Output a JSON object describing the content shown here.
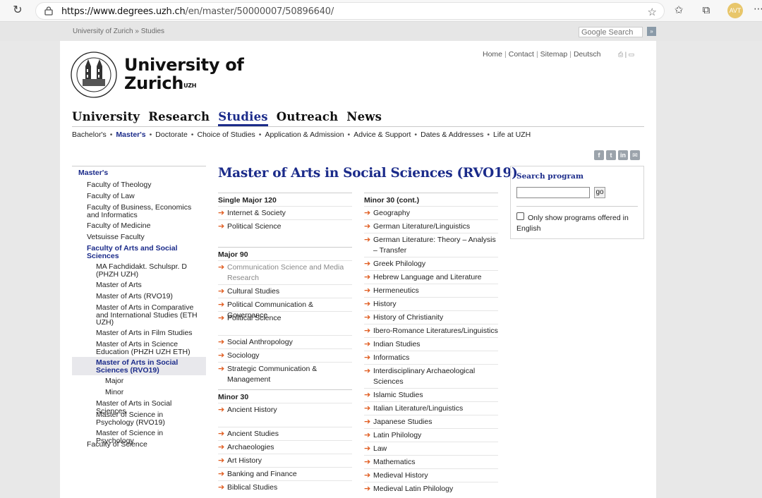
{
  "browser": {
    "url_host": "https://www.degrees.uzh.ch",
    "url_path": "/en/master/50000007/50896640/",
    "avatar_text": "AVT"
  },
  "topbar": {
    "breadcrumb": "University of Zurich » Studies",
    "search_placeholder": "Google Search",
    "search_button": "»"
  },
  "header": {
    "links": [
      "Home",
      "Contact",
      "Sitemap",
      "Deutsch"
    ],
    "logo_line1": "University of",
    "logo_line2": "Zurich",
    "logo_sup": "UZH"
  },
  "mainnav": [
    {
      "label": "University"
    },
    {
      "label": "Research"
    },
    {
      "label": "Studies",
      "active": true
    },
    {
      "label": "Outreach"
    },
    {
      "label": "News"
    }
  ],
  "subnav": [
    {
      "label": "Bachelor's"
    },
    {
      "label": "Master's",
      "active": true
    },
    {
      "label": "Doctorate"
    },
    {
      "label": "Choice of Studies"
    },
    {
      "label": "Application & Admission"
    },
    {
      "label": "Advice & Support"
    },
    {
      "label": "Dates & Addresses"
    },
    {
      "label": "Life at UZH"
    }
  ],
  "social": [
    "f",
    "t",
    "in",
    "✉"
  ],
  "leftnav": {
    "header": "Master's",
    "items": [
      {
        "label": "Faculty of Theology",
        "level": 1
      },
      {
        "label": "Faculty of Law",
        "level": 1
      },
      {
        "label": "Faculty of Business, Economics and Informatics",
        "level": 1
      },
      {
        "label": "Faculty of Medicine",
        "level": 1
      },
      {
        "label": "Vetsuisse Faculty",
        "level": 1
      },
      {
        "label": "Faculty of Arts and Social Sciences",
        "level": 1,
        "active": true
      },
      {
        "label": "MA Fachdidakt. Schulspr. D (PHZH UZH)",
        "level": 2
      },
      {
        "label": "Master of Arts",
        "level": 2
      },
      {
        "label": "Master of Arts (RVO19)",
        "level": 2
      },
      {
        "label": "Master of Arts in Comparative and International Studies (ETH UZH)",
        "level": 2
      },
      {
        "label": "Master of Arts in Film Studies",
        "level": 2
      },
      {
        "label": "Master of Arts in Science Education (PHZH UZH ETH)",
        "level": 2
      },
      {
        "label": "Master of Arts in Social Sciences (RVO19)",
        "level": 2,
        "active": true,
        "selected": true
      },
      {
        "label": "Major",
        "level": 3
      },
      {
        "label": "Minor",
        "level": 3
      },
      {
        "label": "Master of Arts in Social Sciences",
        "level": 2
      },
      {
        "label": "Master of Science in Psychology (RVO19)",
        "level": 2
      },
      {
        "label": "Master of Science in Psychology",
        "level": 2
      },
      {
        "label": "Faculty of Science",
        "level": 1
      }
    ]
  },
  "main": {
    "title": "Master of Arts in Social Sciences (RVO19)",
    "col1": [
      {
        "header": "Single Major 120",
        "items": [
          {
            "label": "Internet & Society"
          },
          {
            "label": "Political Science"
          }
        ]
      },
      {
        "header": "Major 90",
        "items": [
          {
            "label": "Communication Science and Media Research",
            "muted": true
          },
          {
            "label": "Cultural Studies"
          },
          {
            "label": "Political Communication & Governance"
          },
          {
            "label": "Political Science"
          },
          {
            "label": "Social Anthropology"
          },
          {
            "label": "Sociology"
          },
          {
            "label": "Strategic Communication & Management"
          }
        ]
      },
      {
        "header": "Minor 30",
        "items": [
          {
            "label": "Ancient History"
          },
          {
            "label": "Ancient Studies"
          },
          {
            "label": "Archaeologies"
          },
          {
            "label": "Art History"
          },
          {
            "label": "Banking and Finance"
          },
          {
            "label": "Biblical Studies"
          }
        ]
      }
    ],
    "col2": [
      {
        "header": "Minor 30 (cont.)",
        "items": [
          {
            "label": "Geography"
          },
          {
            "label": "German Literature/Linguistics"
          },
          {
            "label": "German Literature: Theory – Analysis – Transfer"
          },
          {
            "label": "Greek Philology"
          },
          {
            "label": "Hebrew Language and Literature"
          },
          {
            "label": "Hermeneutics"
          },
          {
            "label": "History"
          },
          {
            "label": "History of Christianity"
          },
          {
            "label": "Ibero-Romance Literatures/Linguistics"
          },
          {
            "label": "Indian Studies"
          },
          {
            "label": "Informatics"
          },
          {
            "label": "Interdisciplinary Archaeological Sciences"
          },
          {
            "label": "Islamic Studies"
          },
          {
            "label": "Italian Literature/Linguistics"
          },
          {
            "label": "Japanese Studies"
          },
          {
            "label": "Latin Philology"
          },
          {
            "label": "Law"
          },
          {
            "label": "Mathematics"
          },
          {
            "label": "Medieval History"
          },
          {
            "label": "Medieval Latin Philology"
          }
        ]
      }
    ]
  },
  "search_program": {
    "title": "Search program",
    "go_label": "go",
    "checkbox_label": "Only show programs offered in English"
  },
  "colors": {
    "brand": "#1b2b8a",
    "arrow": "#e05a1d"
  }
}
